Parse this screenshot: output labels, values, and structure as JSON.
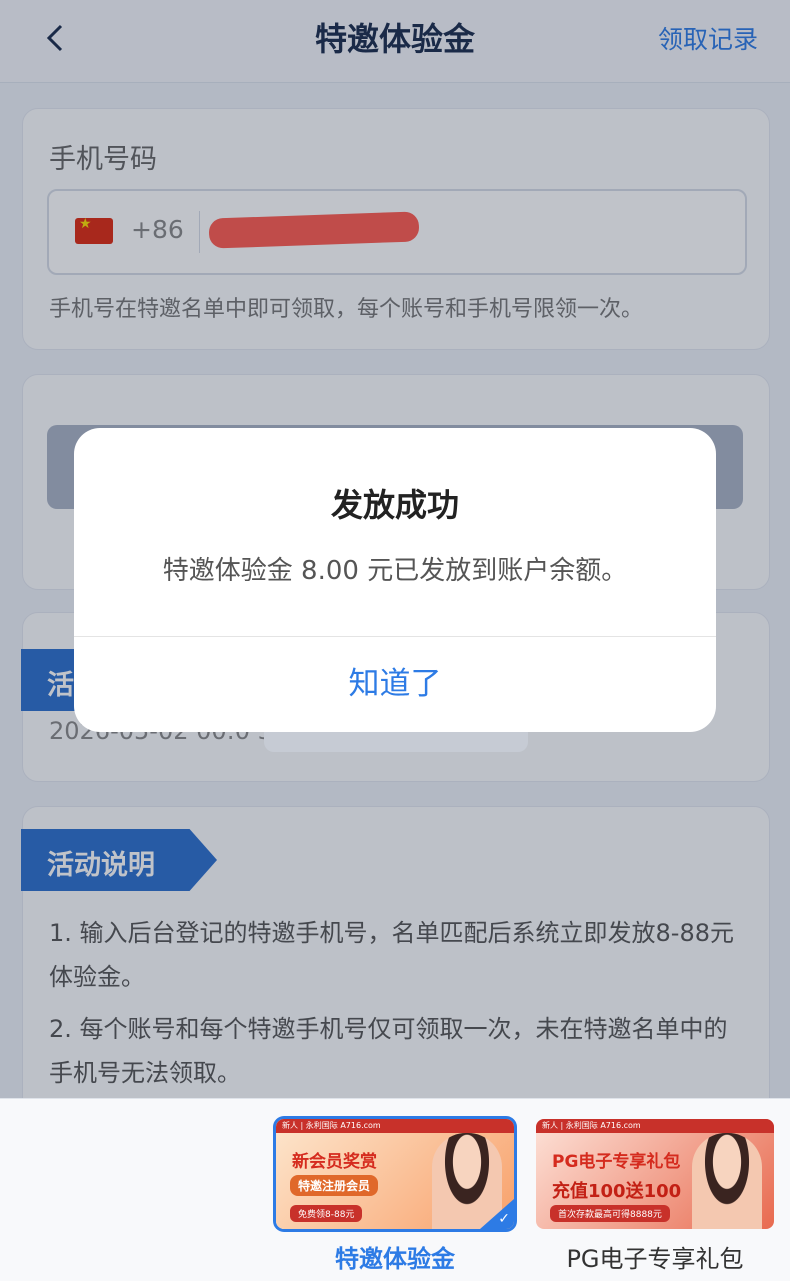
{
  "header": {
    "title": "特邀体验金",
    "records_label": "领取记录"
  },
  "phone_form": {
    "label": "手机号码",
    "country_code": "+86",
    "hint": "手机号在特邀名单中即可领取，每个账号和手机号限领一次。"
  },
  "time_section": {
    "title": "活",
    "time_text": "2026-05-02 00:0                                            3:59:59"
  },
  "description": {
    "title": "活动说明",
    "items": [
      "1. 输入后台登记的特邀手机号，名单匹配后系统立即发放8-88元体验金。",
      "2. 每个账号和每个特邀手机号仅可领取一次，未在特邀名单中的手机号无法领取。"
    ]
  },
  "dialog": {
    "title": "发放成功",
    "message": "特邀体验金 8.00 元已发放到账户余额。",
    "confirm_label": "知道了"
  },
  "bottom_tabs": [
    {
      "label": "特邀体验金",
      "banner_top": "新人 | 永利国际 A716.com",
      "banner_title": "新会员奖赏",
      "banner_sub": "特邀注册会员",
      "banner_foot": "免费领8-88元"
    },
    {
      "label": "PG电子专享礼包",
      "banner_top": "新人 | 永利国际 A716.com",
      "banner_title": "PG电子专享礼包",
      "banner_sub": "充值100送100",
      "banner_foot": "首次存款最高可得8888元"
    }
  ],
  "colors": {
    "accent": "#2d7be5",
    "tag": "#2b6fce",
    "redaction": "#ff5a4f"
  }
}
